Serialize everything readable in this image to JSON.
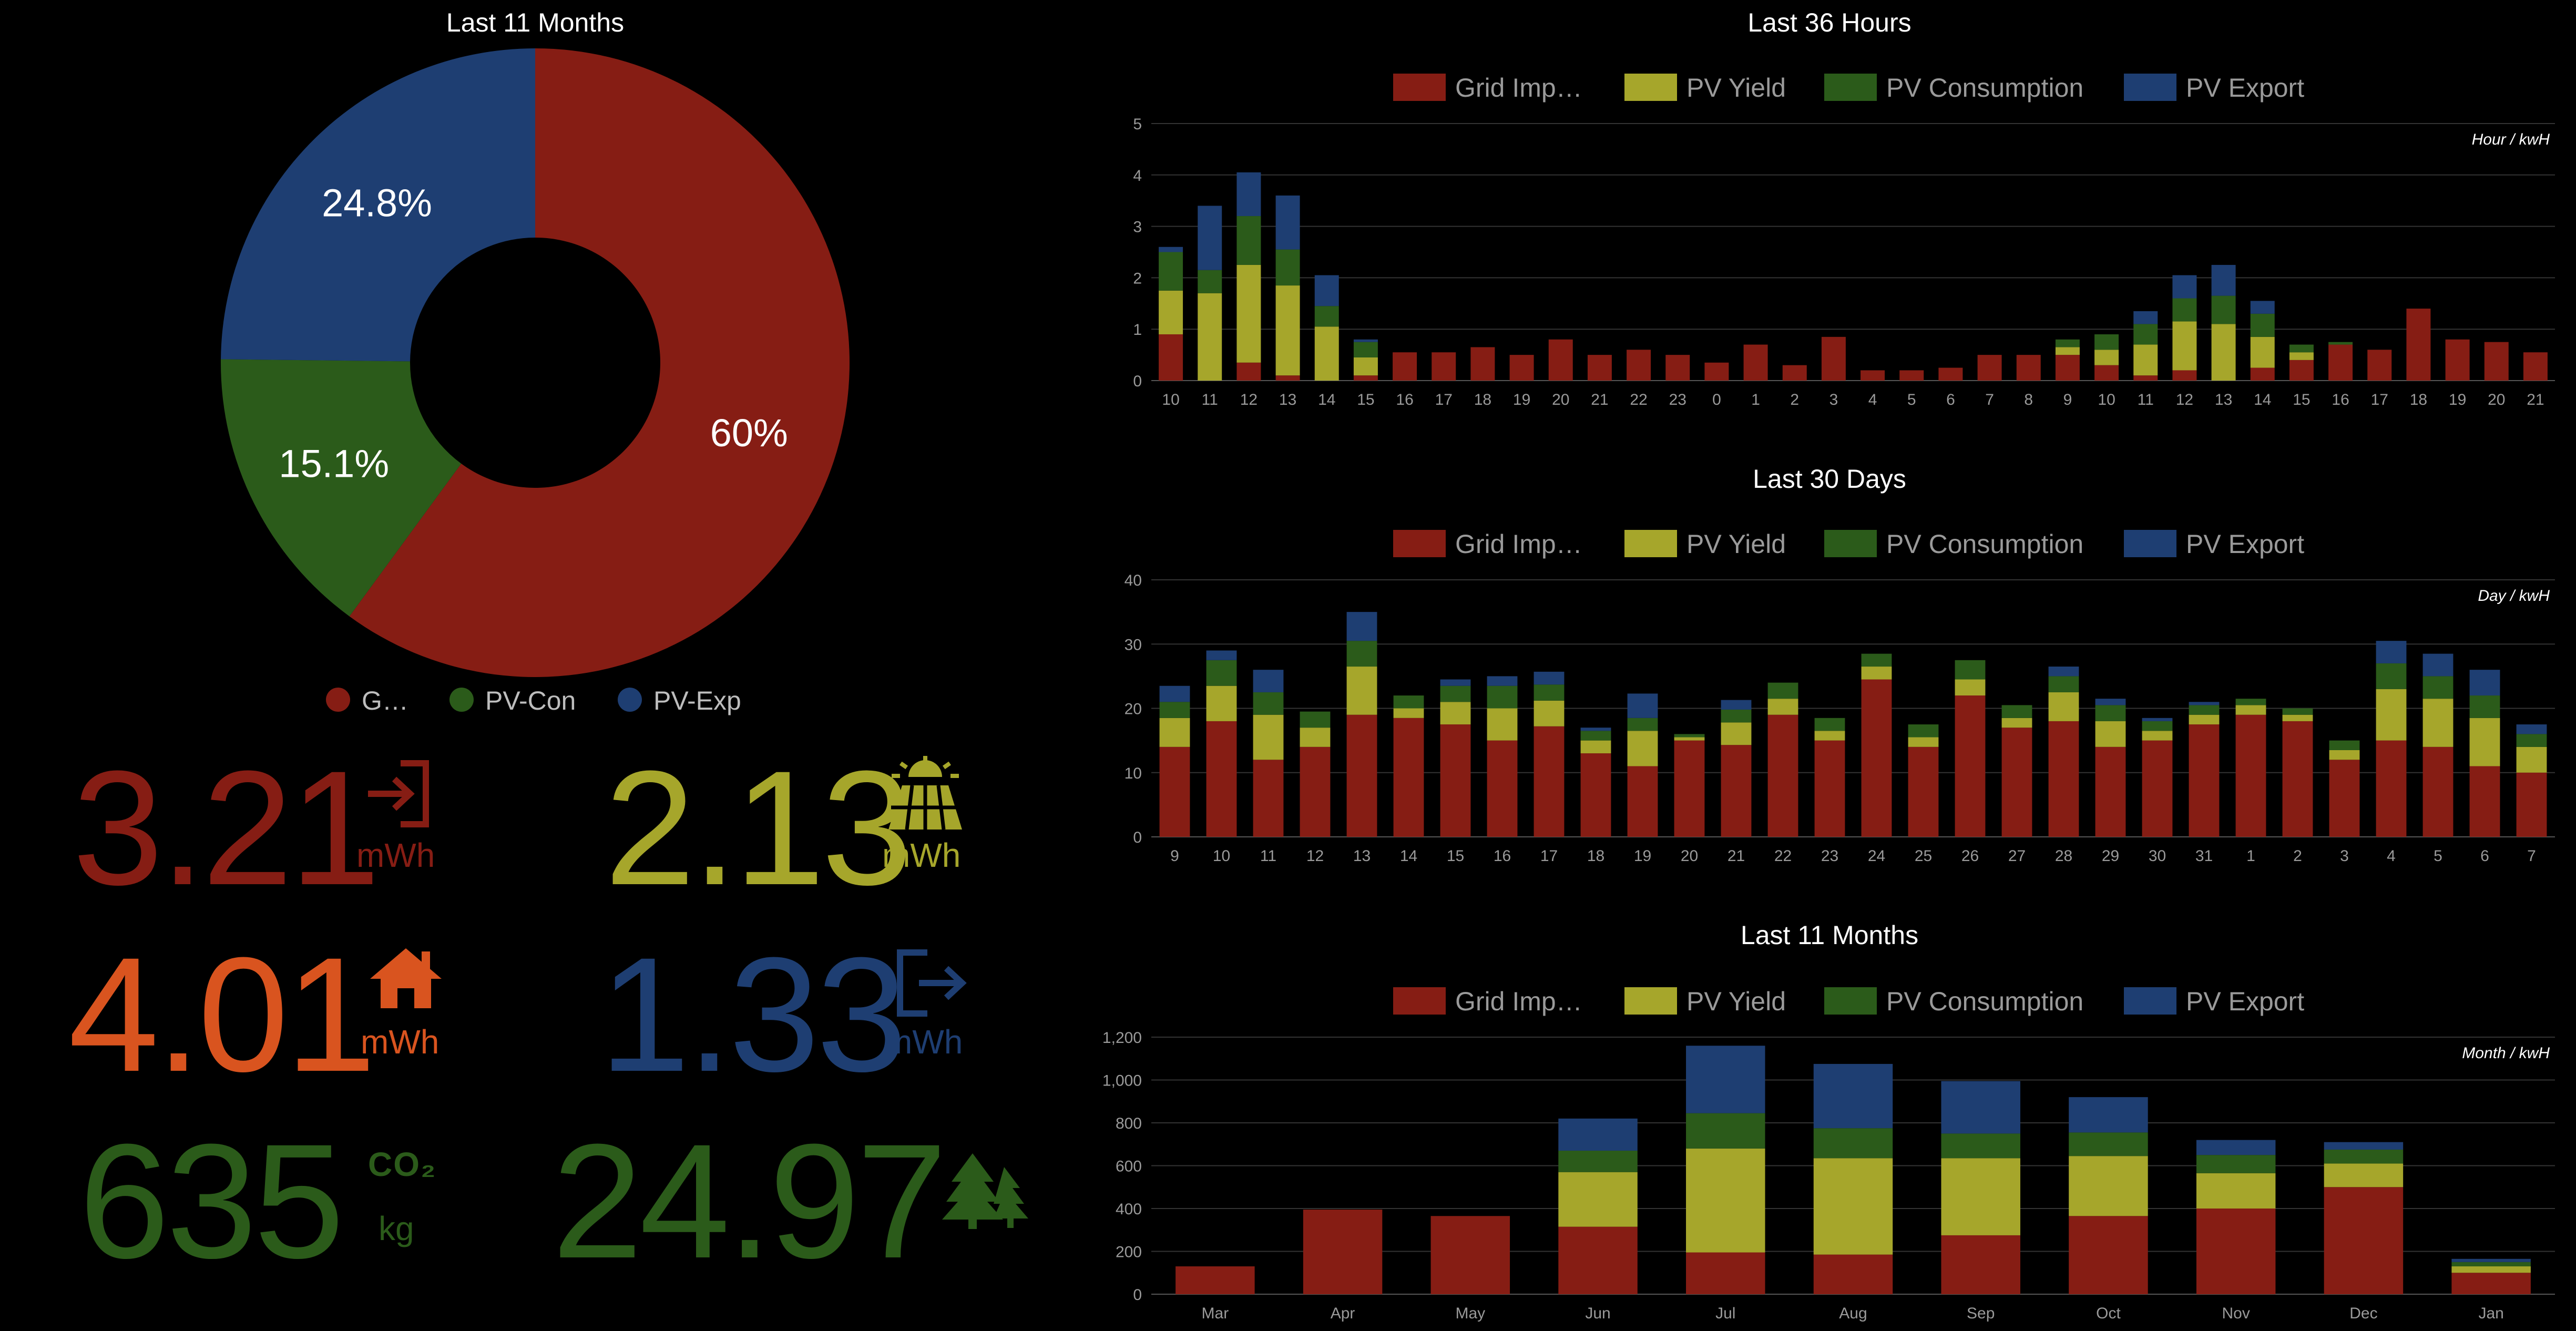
{
  "colors": {
    "grid": "#861d14",
    "pv_yield": "#a6a62b",
    "pv_consumption": "#2b5b1a",
    "pv_export": "#1e3e72",
    "kpi_grid": "#861d14",
    "kpi_pv": "#a6a62b",
    "kpi_home": "#d9541f",
    "kpi_export": "#1e3e72",
    "kpi_green": "#2b5b1a"
  },
  "pie": {
    "title": "Last 11 Months",
    "legend": [
      "G…",
      "PV-Con",
      "PV-Exp"
    ]
  },
  "kpis": {
    "grid_import": {
      "value": "3.21",
      "unit": "mWh",
      "icon": "grid-import-icon"
    },
    "pv_yield": {
      "value": "2.13",
      "unit": "mWh",
      "icon": "solar-panel-icon"
    },
    "consumption": {
      "value": "4.01",
      "unit": "mWh",
      "icon": "home-icon"
    },
    "pv_export": {
      "value": "1.33",
      "unit": "mWh",
      "icon": "export-icon"
    },
    "co2": {
      "value": "635",
      "label": "CO₂",
      "unit": "kg",
      "icon": "co2-icon"
    },
    "trees": {
      "value": "24.97",
      "icon": "trees-icon"
    }
  },
  "chart_data": [
    {
      "type": "pie",
      "title": "Last 11 Months",
      "slices": [
        {
          "name": "G…",
          "value": 60,
          "label": "60%",
          "color": "#861d14"
        },
        {
          "name": "PV-Con",
          "value": 15.1,
          "label": "15.1%",
          "color": "#2b5b1a"
        },
        {
          "name": "PV-Exp",
          "value": 24.8,
          "label": "24.8%",
          "color": "#1e3e72"
        }
      ]
    },
    {
      "type": "bar",
      "stacked": true,
      "title": "Last 36 Hours",
      "unit_label": "Hour / kwH",
      "legend": [
        "Grid Imp…",
        "PV Yield",
        "PV Consumption",
        "PV Export"
      ],
      "ylim": [
        0,
        5
      ],
      "yticks": [
        "0",
        "1",
        "2",
        "3",
        "4",
        "5"
      ],
      "ytick_values": [
        0,
        1,
        2,
        3,
        4,
        5
      ],
      "categories": [
        "10",
        "11",
        "12",
        "13",
        "14",
        "15",
        "16",
        "17",
        "18",
        "19",
        "20",
        "21",
        "22",
        "23",
        "0",
        "1",
        "2",
        "3",
        "4",
        "5",
        "6",
        "7",
        "8",
        "9",
        "10",
        "11",
        "12",
        "13",
        "14",
        "15",
        "16",
        "17",
        "18",
        "19",
        "20",
        "21"
      ],
      "series": [
        {
          "name": "Grid Imp…",
          "color": "#861d14",
          "values": [
            0.9,
            0,
            0.35,
            0.1,
            0,
            0.1,
            0.55,
            0.55,
            0.65,
            0.5,
            0.8,
            0.5,
            0.6,
            0.5,
            0.35,
            0.7,
            0.3,
            0.85,
            0.2,
            0.2,
            0.25,
            0.5,
            0.5,
            0.5,
            0.3,
            0.1,
            0.2,
            0,
            0.25,
            0.4,
            0.7,
            0.6,
            1.4,
            0.8,
            0.75,
            0.55
          ]
        },
        {
          "name": "PV Yield",
          "color": "#a6a62b",
          "values": [
            0.85,
            1.7,
            1.9,
            1.75,
            1.05,
            0.35,
            0,
            0,
            0,
            0,
            0,
            0,
            0,
            0,
            0,
            0,
            0,
            0,
            0,
            0,
            0,
            0,
            0,
            0.15,
            0.3,
            0.6,
            0.95,
            1.1,
            0.6,
            0.15,
            0,
            0,
            0,
            0,
            0,
            0
          ]
        },
        {
          "name": "PV Consumption",
          "color": "#2b5b1a",
          "values": [
            0.75,
            0.45,
            0.95,
            0.7,
            0.4,
            0.3,
            0,
            0,
            0,
            0,
            0,
            0,
            0,
            0,
            0,
            0,
            0,
            0,
            0,
            0,
            0,
            0,
            0,
            0.15,
            0.3,
            0.4,
            0.45,
            0.55,
            0.45,
            0.15,
            0.05,
            0,
            0,
            0,
            0,
            0
          ]
        },
        {
          "name": "PV Export",
          "color": "#1e3e72",
          "values": [
            0.1,
            1.25,
            0.85,
            1.05,
            0.6,
            0.05,
            0,
            0,
            0,
            0,
            0,
            0,
            0,
            0,
            0,
            0,
            0,
            0,
            0,
            0,
            0,
            0,
            0,
            0,
            0,
            0.25,
            0.45,
            0.6,
            0.25,
            0,
            0,
            0,
            0,
            0,
            0,
            0
          ]
        }
      ]
    },
    {
      "type": "bar",
      "stacked": true,
      "title": "Last 30 Days",
      "unit_label": "Day / kwH",
      "legend": [
        "Grid Imp…",
        "PV Yield",
        "PV Consumption",
        "PV Export"
      ],
      "ylim": [
        0,
        40
      ],
      "yticks": [
        "0",
        "10",
        "20",
        "30",
        "40"
      ],
      "ytick_values": [
        0,
        10,
        20,
        30,
        40
      ],
      "categories": [
        "9",
        "10",
        "11",
        "12",
        "13",
        "14",
        "15",
        "16",
        "17",
        "18",
        "19",
        "20",
        "21",
        "22",
        "23",
        "24",
        "25",
        "26",
        "27",
        "28",
        "29",
        "30",
        "31",
        "1",
        "2",
        "3",
        "4",
        "5",
        "6",
        "7"
      ],
      "series": [
        {
          "name": "Grid Imp…",
          "color": "#861d14",
          "values": [
            14,
            18,
            12,
            14,
            19,
            18.5,
            17.5,
            15,
            17.2,
            13,
            11,
            15,
            14.3,
            19,
            15,
            24.5,
            14,
            22,
            17,
            18,
            14,
            15,
            17.5,
            19,
            18,
            12,
            15,
            14,
            11,
            10
          ]
        },
        {
          "name": "PV Yield",
          "color": "#a6a62b",
          "values": [
            4.5,
            5.5,
            7,
            3,
            7.5,
            1.5,
            3.5,
            5,
            4,
            2,
            5.5,
            0.5,
            3.5,
            2.5,
            1.5,
            2,
            1.5,
            2.5,
            1.5,
            4.5,
            4,
            1.5,
            1.5,
            1.5,
            1,
            1.5,
            8,
            7.5,
            7.5,
            4
          ]
        },
        {
          "name": "PV Consumption",
          "color": "#2b5b1a",
          "values": [
            2.5,
            4,
            3.5,
            2.5,
            4,
            2,
            2.5,
            3.5,
            2.5,
            1.5,
            2,
            0.5,
            2,
            2.5,
            2,
            2,
            2,
            3,
            2,
            2.5,
            2.5,
            1.5,
            1.5,
            1,
            1,
            1.5,
            4,
            3.5,
            3.5,
            2
          ]
        },
        {
          "name": "PV Export",
          "color": "#1e3e72",
          "values": [
            2.5,
            1.5,
            3.5,
            0,
            4.5,
            0,
            1,
            1.5,
            2,
            0.5,
            3.8,
            0,
            1.5,
            0,
            0,
            0,
            0,
            0,
            0,
            1.5,
            1,
            0.5,
            0.5,
            0,
            0,
            0,
            3.5,
            3.5,
            4,
            1.5
          ]
        }
      ]
    },
    {
      "type": "bar",
      "stacked": true,
      "title": "Last 11 Months",
      "unit_label": "Month / kwH",
      "legend": [
        "Grid Imp…",
        "PV Yield",
        "PV Consumption",
        "PV Export"
      ],
      "ylim": [
        0,
        1200
      ],
      "yticks": [
        "0",
        "200",
        "400",
        "600",
        "800",
        "1,000",
        "1,200"
      ],
      "ytick_values": [
        0,
        200,
        400,
        600,
        800,
        1000,
        1200
      ],
      "categories": [
        "Mar",
        "Apr",
        "May",
        "Jun",
        "Jul",
        "Aug",
        "Sep",
        "Oct",
        "Nov",
        "Dec",
        "Jan"
      ],
      "series": [
        {
          "name": "Grid Imp…",
          "color": "#861d14",
          "values": [
            130,
            395,
            365,
            315,
            195,
            185,
            275,
            365,
            400,
            500,
            100
          ]
        },
        {
          "name": "PV Yield",
          "color": "#a6a62b",
          "values": [
            0,
            0,
            0,
            255,
            485,
            450,
            360,
            280,
            165,
            110,
            30
          ]
        },
        {
          "name": "PV Consumption",
          "color": "#2b5b1a",
          "values": [
            0,
            0,
            0,
            100,
            165,
            140,
            115,
            110,
            85,
            65,
            20
          ]
        },
        {
          "name": "PV Export",
          "color": "#1e3e72",
          "values": [
            0,
            0,
            0,
            150,
            315,
            300,
            245,
            165,
            70,
            35,
            15
          ]
        }
      ]
    }
  ]
}
